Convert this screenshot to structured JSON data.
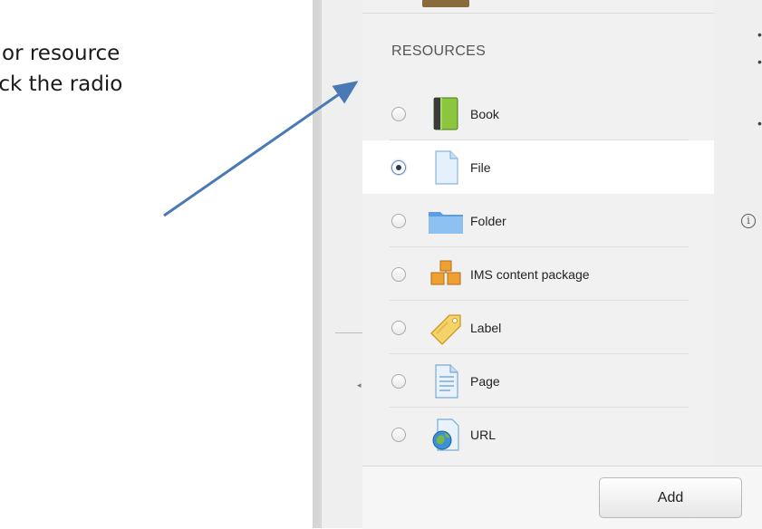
{
  "instructions": {
    "line1": "or resource",
    "line2": "ick the radio"
  },
  "resources": {
    "title": "RESOURCES",
    "items": [
      {
        "label": "Book",
        "icon": "book-icon",
        "selected": false
      },
      {
        "label": "File",
        "icon": "file-icon",
        "selected": true
      },
      {
        "label": "Folder",
        "icon": "folder-icon",
        "selected": false
      },
      {
        "label": "IMS content package",
        "icon": "ims-package-icon",
        "selected": false
      },
      {
        "label": "Label",
        "icon": "label-tag-icon",
        "selected": false
      },
      {
        "label": "Page",
        "icon": "page-icon",
        "selected": false
      },
      {
        "label": "URL",
        "icon": "url-globe-icon",
        "selected": false
      }
    ]
  },
  "footer": {
    "add_label": "Add"
  },
  "colors": {
    "arrow": "#4a7ab5",
    "selected_row": "#ffffff",
    "panel": "#efefef"
  }
}
